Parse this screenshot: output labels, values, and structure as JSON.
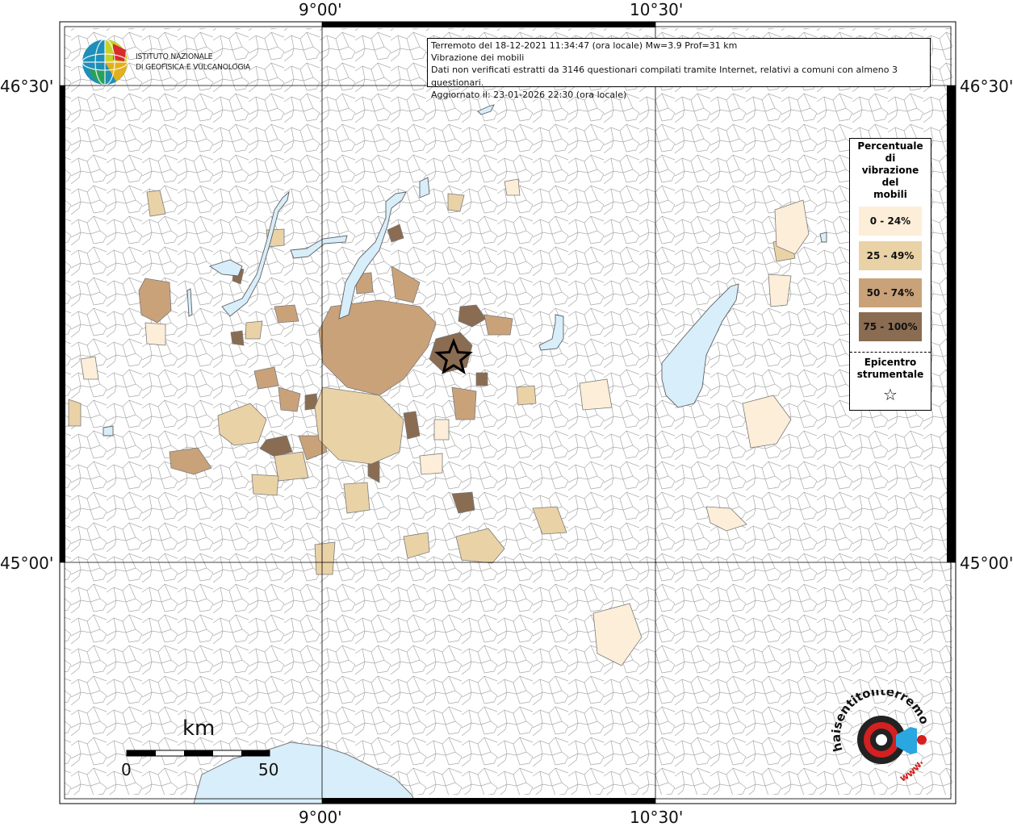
{
  "axis": {
    "top_ticks": [
      "9°00'",
      "10°30'"
    ],
    "bottom_ticks": [
      "9°00'",
      "10°30'"
    ],
    "left_ticks": [
      "46°30'",
      "45°00'"
    ],
    "right_ticks": [
      "46°30'",
      "45°00'"
    ]
  },
  "info": {
    "line1": "Terremoto del 18-12-2021 11:34:47 (ora locale) Mw=3.9 Prof=31 km",
    "line2": "Vibrazione dei mobili",
    "line3": "Dati non verificati estratti da 3146 questionari compilati tramite Internet, relativi a comuni con almeno 3 questionari.",
    "line4": "Aggiornato il: 23-01-2026 22:30 (ora locale)"
  },
  "logo_ingv": {
    "line1": "ISTITUTO NAZIONALE",
    "line2": "DI GEOFISICA E VULCANOLOGIA"
  },
  "legend": {
    "title": [
      "Percentuale",
      "di",
      "vibrazione",
      "del",
      "mobili"
    ],
    "classes": [
      {
        "label": "0 - 24%",
        "color": "#fdeed9"
      },
      {
        "label": "25 - 49%",
        "color": "#ead2a7"
      },
      {
        "label": "50 - 74%",
        "color": "#c9a27a"
      },
      {
        "label": "75 - 100%",
        "color": "#8a6c52"
      }
    ],
    "epicenter_title": [
      "Epicentro",
      "strumentale"
    ],
    "epicenter_symbol": "☆"
  },
  "scale_bar": {
    "unit": "km",
    "min_label": "0",
    "max_label": "50"
  },
  "logo_hst": {
    "text": "haisentitoilterremoto.it",
    "www": "www."
  },
  "colors": {
    "lake": "#d8eefa",
    "border": "#7a7a7a",
    "grid": "#000000"
  }
}
